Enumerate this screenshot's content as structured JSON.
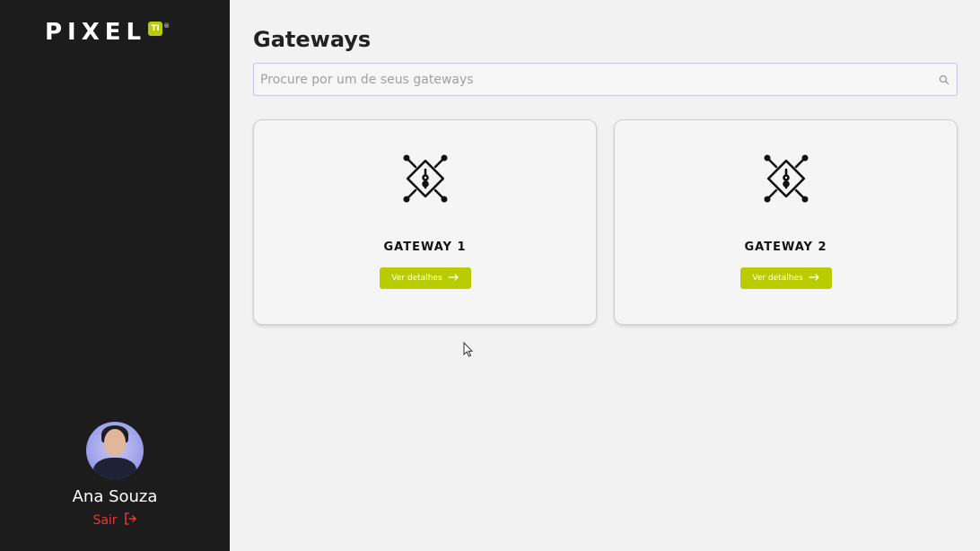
{
  "brand": {
    "logo_text": "PIXEL",
    "logo_badge": "TI",
    "logo_mark": "®",
    "accent_color": "#b8cc00"
  },
  "user": {
    "name": "Ana Souza",
    "logout_label": "Sair",
    "logout_icon": "logout-icon"
  },
  "page": {
    "title": "Gateways"
  },
  "search": {
    "placeholder": "Procure por um de seus gateways",
    "value": "",
    "icon": "search-icon"
  },
  "gateways": [
    {
      "name": "GATEWAY 1",
      "button_label": "Ver detalhes",
      "icon": "gateway-chip-icon"
    },
    {
      "name": "GATEWAY 2",
      "button_label": "Ver detalhes",
      "icon": "gateway-chip-icon"
    }
  ]
}
